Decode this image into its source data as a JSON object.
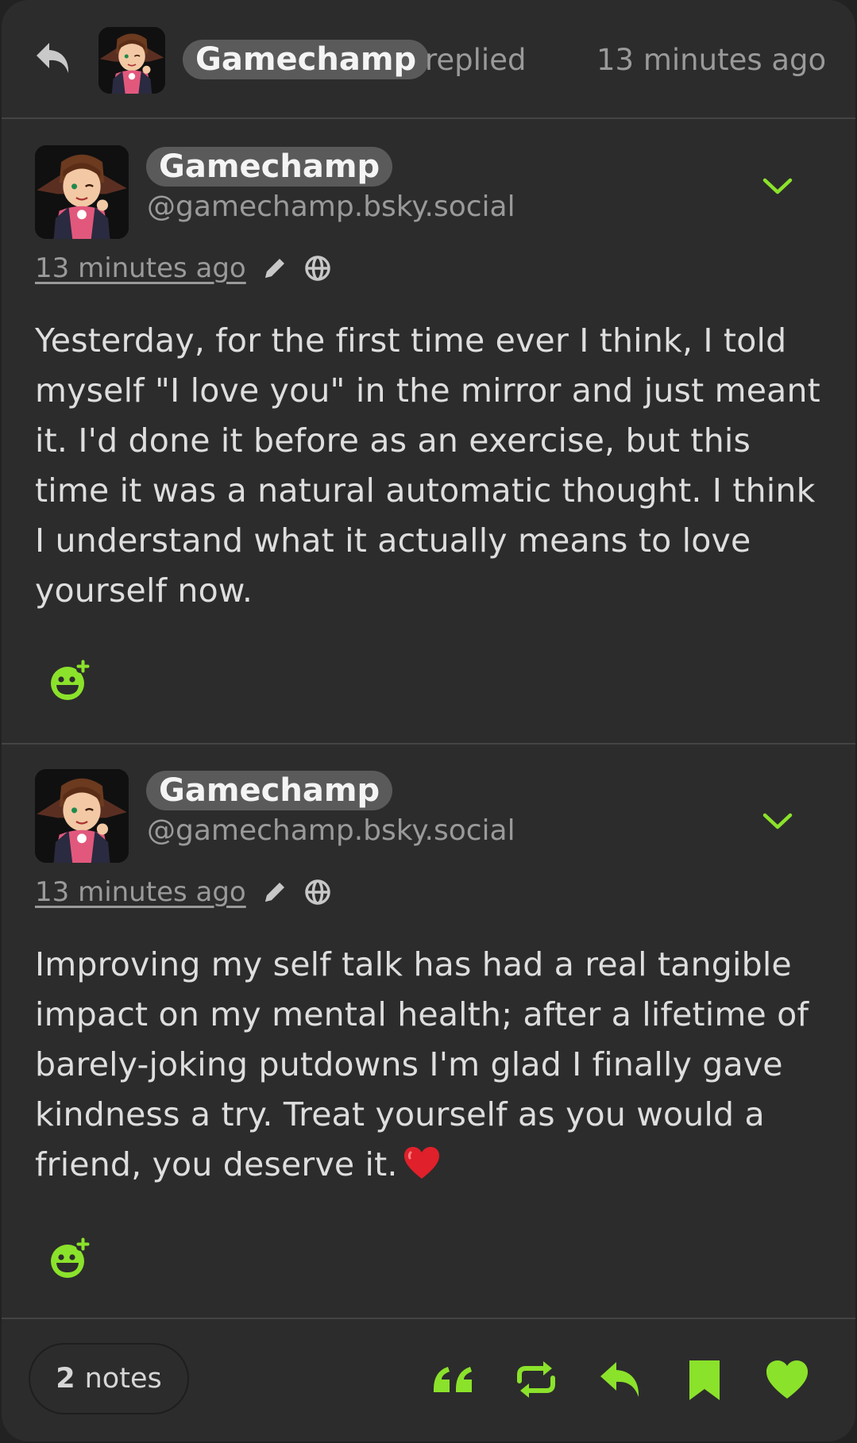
{
  "colors": {
    "accent": "#8be22b",
    "background": "#2c2c2c",
    "pill_bg": "#5a5a5a",
    "muted_text": "#9a9a9a",
    "heart_emoji": "#e0202a"
  },
  "header": {
    "reply_icon": "reply-arrow-icon",
    "author_name": "Gamechamp",
    "action_label": "replied",
    "timestamp": "13 minutes ago"
  },
  "posts": [
    {
      "author_name": "Gamechamp",
      "handle": "@gamechamp.bsky.social",
      "timestamp": "13 minutes ago",
      "edit_icon": "pencil-icon",
      "visibility_icon": "globe-icon",
      "body": "Yesterday, for the first time ever I think, I told myself \"I love you\" in the mirror and just meant it. I'd done it before as an exercise, but this time it was a natural automatic thought. I think I understand what it actually means to love yourself now.",
      "react_icon": "add-reaction-icon"
    },
    {
      "author_name": "Gamechamp",
      "handle": "@gamechamp.bsky.social",
      "timestamp": "13 minutes ago",
      "edit_icon": "pencil-icon",
      "visibility_icon": "globe-icon",
      "body": "Improving my self talk has had a real tangible impact on my mental health; after a lifetime of barely-joking putdowns I'm glad I finally gave kindness a try. Treat yourself as you would a friend, you deserve it.",
      "react_icon": "add-reaction-icon"
    }
  ],
  "footer": {
    "notes_count": "2",
    "notes_label": "notes",
    "actions": [
      "quote-icon",
      "reblog-icon",
      "reply-icon",
      "bookmark-icon",
      "like-heart-icon"
    ]
  }
}
